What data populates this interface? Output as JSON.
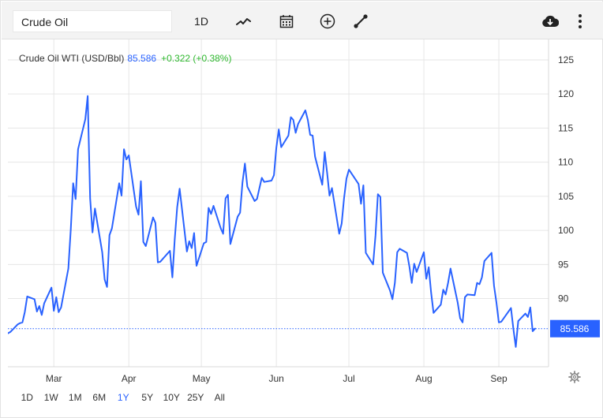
{
  "toolbar": {
    "search_value": "Crude Oil",
    "interval_label": "1D",
    "icons": [
      "chart-type-icon",
      "calendar-icon",
      "add-comparison-icon",
      "draw-tool-icon",
      "download-icon",
      "more-menu-icon"
    ]
  },
  "legend": {
    "name": "Crude Oil WTI (USD/Bbl)",
    "price": "85.586",
    "change": "+0.322 (+0.38%)"
  },
  "ranges": {
    "items": [
      "1D",
      "1W",
      "1M",
      "6M",
      "1Y",
      "5Y",
      "10Y",
      "25Y",
      "All"
    ],
    "active": "1Y"
  },
  "colors": {
    "line": "#2962ff",
    "up": "#2eb82e",
    "price_tag_bg": "#2962ff",
    "grid": "#e6e6e6"
  },
  "chart_data": {
    "type": "line",
    "title": "Crude Oil WTI (USD/Bbl)",
    "xlabel": "",
    "ylabel": "",
    "ylim": [
      80,
      128
    ],
    "y_ticks": [
      90,
      95,
      100,
      105,
      110,
      115,
      120,
      125
    ],
    "x_ticks": [
      "Mar",
      "Apr",
      "May",
      "Jun",
      "Jul",
      "Aug",
      "Sep"
    ],
    "grid": true,
    "last_price_label": "85.586",
    "series": [
      {
        "name": "Crude Oil WTI (USD/Bbl)",
        "x": [
          "2022-02-10",
          "2022-02-11",
          "2022-02-14",
          "2022-02-15",
          "2022-02-16",
          "2022-02-17",
          "2022-02-18",
          "2022-02-21",
          "2022-02-22",
          "2022-02-23",
          "2022-02-24",
          "2022-02-25",
          "2022-02-28",
          "2022-03-01",
          "2022-03-02",
          "2022-03-03",
          "2022-03-04",
          "2022-03-07",
          "2022-03-08",
          "2022-03-09",
          "2022-03-10",
          "2022-03-11",
          "2022-03-14",
          "2022-03-15",
          "2022-03-16",
          "2022-03-17",
          "2022-03-18",
          "2022-03-21",
          "2022-03-22",
          "2022-03-23",
          "2022-03-24",
          "2022-03-25",
          "2022-03-28",
          "2022-03-29",
          "2022-03-30",
          "2022-03-31",
          "2022-04-01",
          "2022-04-04",
          "2022-04-05",
          "2022-04-06",
          "2022-04-07",
          "2022-04-08",
          "2022-04-11",
          "2022-04-12",
          "2022-04-13",
          "2022-04-14",
          "2022-04-18",
          "2022-04-19",
          "2022-04-20",
          "2022-04-21",
          "2022-04-22",
          "2022-04-25",
          "2022-04-26",
          "2022-04-27",
          "2022-04-28",
          "2022-04-29",
          "2022-05-02",
          "2022-05-03",
          "2022-05-04",
          "2022-05-05",
          "2022-05-06",
          "2022-05-09",
          "2022-05-10",
          "2022-05-11",
          "2022-05-12",
          "2022-05-13",
          "2022-05-16",
          "2022-05-17",
          "2022-05-18",
          "2022-05-19",
          "2022-05-20",
          "2022-05-23",
          "2022-05-24",
          "2022-05-25",
          "2022-05-26",
          "2022-05-27",
          "2022-05-30",
          "2022-05-31",
          "2022-06-01",
          "2022-06-02",
          "2022-06-03",
          "2022-06-06",
          "2022-06-07",
          "2022-06-08",
          "2022-06-09",
          "2022-06-10",
          "2022-06-13",
          "2022-06-14",
          "2022-06-15",
          "2022-06-16",
          "2022-06-17",
          "2022-06-20",
          "2022-06-21",
          "2022-06-22",
          "2022-06-23",
          "2022-06-24",
          "2022-06-27",
          "2022-06-28",
          "2022-06-29",
          "2022-06-30",
          "2022-07-01",
          "2022-07-05",
          "2022-07-06",
          "2022-07-07",
          "2022-07-08",
          "2022-07-11",
          "2022-07-12",
          "2022-07-13",
          "2022-07-14",
          "2022-07-15",
          "2022-07-18",
          "2022-07-19",
          "2022-07-20",
          "2022-07-21",
          "2022-07-22",
          "2022-07-25",
          "2022-07-26",
          "2022-07-27",
          "2022-07-28",
          "2022-07-29",
          "2022-08-01",
          "2022-08-02",
          "2022-08-03",
          "2022-08-04",
          "2022-08-05",
          "2022-08-08",
          "2022-08-09",
          "2022-08-10",
          "2022-08-11",
          "2022-08-12",
          "2022-08-15",
          "2022-08-16",
          "2022-08-17",
          "2022-08-18",
          "2022-08-19",
          "2022-08-22",
          "2022-08-23",
          "2022-08-24",
          "2022-08-25",
          "2022-08-26",
          "2022-08-29",
          "2022-08-30",
          "2022-08-31",
          "2022-09-01",
          "2022-09-02",
          "2022-09-06",
          "2022-09-07",
          "2022-09-08",
          "2022-09-09",
          "2022-09-12",
          "2022-09-13",
          "2022-09-14",
          "2022-09-15",
          "2022-09-16"
        ],
        "values": [
          84.9,
          85.1,
          86.2,
          86.4,
          86.5,
          88.0,
          90.3,
          89.9,
          88.1,
          88.9,
          87.6,
          89.3,
          91.6,
          88.2,
          90.2,
          88.0,
          88.7,
          94.4,
          100.2,
          106.9,
          104.6,
          111.9,
          116.3,
          119.7,
          104.7,
          99.7,
          103.2,
          96.8,
          92.8,
          91.7,
          99.3,
          100.3,
          106.9,
          105.1,
          111.9,
          110.4,
          111.0,
          103.5,
          102.3,
          107.2,
          98.3,
          97.7,
          101.9,
          101.1,
          95.3,
          95.4,
          97.0,
          93.1,
          98.7,
          103.4,
          106.1,
          96.9,
          98.4,
          97.4,
          99.6,
          94.8,
          98.1,
          98.3,
          103.3,
          102.4,
          103.6,
          100.3,
          99.5,
          104.7,
          105.2,
          98.0,
          102.0,
          102.6,
          107.0,
          109.8,
          106.4,
          104.3,
          104.6,
          106.2,
          107.7,
          107.1,
          107.3,
          108.1,
          112.1,
          114.8,
          112.2,
          113.9,
          116.6,
          116.2,
          114.3,
          115.6,
          117.6,
          116.2,
          114.0,
          113.9,
          110.8,
          106.7,
          111.5,
          108.4,
          105.1,
          106.2,
          99.5,
          101.0,
          104.7,
          107.6,
          108.9,
          106.8,
          103.9,
          106.6,
          96.7,
          95.0,
          99.3,
          105.3,
          104.9,
          93.8,
          91.2,
          89.9,
          92.3,
          96.8,
          97.3,
          96.7,
          94.7,
          92.3,
          95.1,
          93.9,
          96.8,
          92.9,
          94.6,
          90.9,
          87.9,
          89.1,
          91.3,
          90.6,
          92.3,
          94.4,
          89.4,
          87.1,
          86.5,
          90.2,
          90.6,
          90.5,
          92.3,
          92.1,
          93.1,
          95.5,
          96.7,
          91.9,
          89.4,
          86.5,
          86.6,
          88.6,
          85.6,
          82.9,
          86.7,
          87.8,
          87.3,
          88.7,
          85.2,
          85.6
        ]
      }
    ]
  }
}
